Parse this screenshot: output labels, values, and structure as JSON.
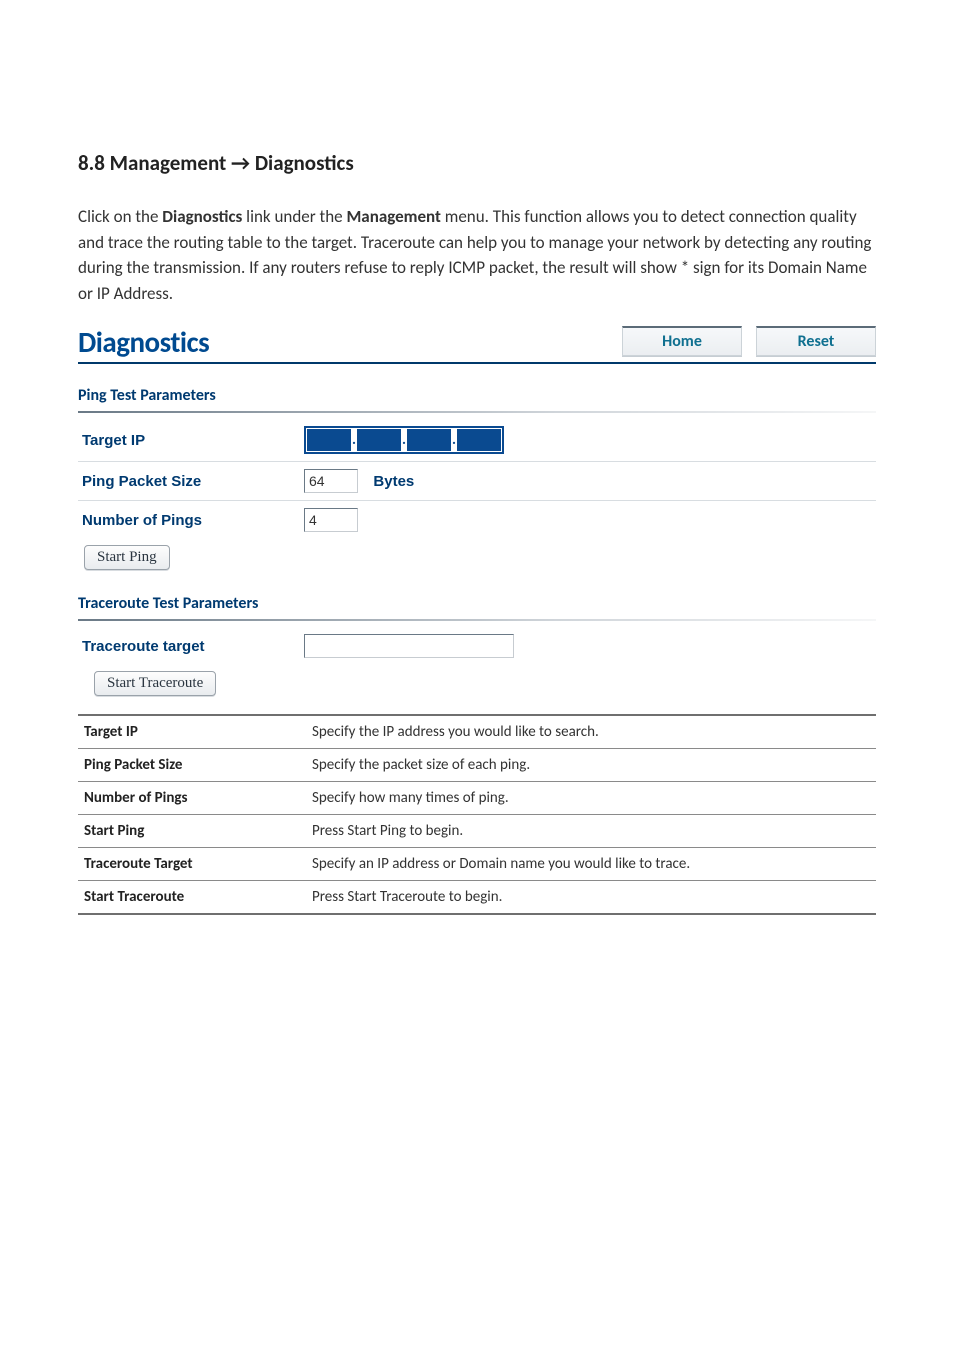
{
  "section_title": "8.8 Management → Diagnostics",
  "intro": {
    "pre1": "Click on the ",
    "b1": "Diagnostics",
    "mid1": " link under the ",
    "b2": "Management",
    "post": " menu. This function allows you to detect connection quality and trace the routing table to the target. Traceroute can help you to manage your network by detecting any routing during the transmission. If any routers refuse to reply ICMP packet, the result will show * sign for its Domain Name or IP Address."
  },
  "diagnostics": {
    "title": "Diagnostics",
    "home": "Home",
    "reset": "Reset"
  },
  "ping": {
    "header": "Ping Test Parameters",
    "target_ip_label": "Target IP",
    "target_ip": {
      "o1": "",
      "o2": "",
      "o3": "",
      "o4": ""
    },
    "packet_size_label": "Ping Packet Size",
    "packet_size_value": "64",
    "bytes_label": "Bytes",
    "num_pings_label": "Number of Pings",
    "num_pings_value": "4",
    "start_ping": "Start Ping"
  },
  "traceroute": {
    "header": "Traceroute Test Parameters",
    "target_label": "Traceroute target",
    "target_value": "",
    "start": "Start Traceroute"
  },
  "defs": [
    {
      "key": "Target IP",
      "val": "Specify the IP address you would like to search."
    },
    {
      "key": "Ping Packet Size",
      "val": "Specify the packet size of each ping."
    },
    {
      "key": "Number of Pings",
      "val": "Specify how many times of ping."
    },
    {
      "key": "Start Ping",
      "val": "Press Start Ping to begin."
    },
    {
      "key": "Traceroute Target",
      "val": "Specify an IP address or Domain name you would like to trace."
    },
    {
      "key": "Start Traceroute",
      "val": "Press Start Traceroute to begin."
    }
  ]
}
